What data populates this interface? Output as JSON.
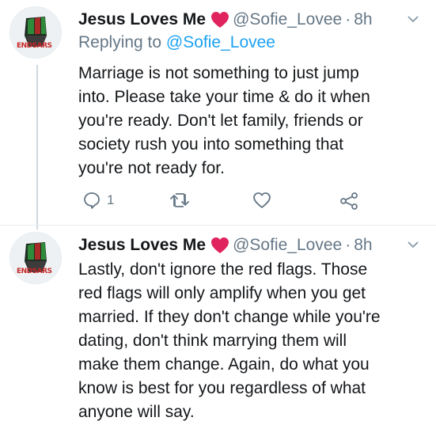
{
  "tweets": [
    {
      "name": "Jesus Loves Me",
      "handle": "@Sofie_Lovee",
      "time": "8h",
      "replying_prefix": "Replying to ",
      "replying_handle": "@Sofie_Lovee",
      "text_lines": [
        "Marriage is not something to just jump",
        "into. Please take your time & do it when",
        "you're ready. Don't let family, friends or",
        "society rush you into something that",
        "you're not ready for."
      ],
      "reply_count": "1"
    },
    {
      "name": "Jesus Loves Me",
      "handle": "@Sofie_Lovee",
      "time": "8h",
      "text_lines": [
        "Lastly, don't ignore the red flags. Those",
        "red flags will only amplify when you get",
        "married. If they don't change while you're",
        "dating, don't think marrying them will",
        "make them change. Again, do what you",
        "know is best for you regardless of what",
        "anyone will say."
      ]
    }
  ],
  "avatar_text": "ENDSARS",
  "icons": {
    "heart": "red-heart-icon",
    "chevron": "chevron-down-icon",
    "reply": "reply-icon",
    "retweet": "retweet-icon",
    "like": "like-icon",
    "share": "share-icon"
  },
  "colors": {
    "secondary": "#657786",
    "link": "#1da1f2",
    "heart": "#e0245e",
    "thread_line": "#cfd9de"
  }
}
